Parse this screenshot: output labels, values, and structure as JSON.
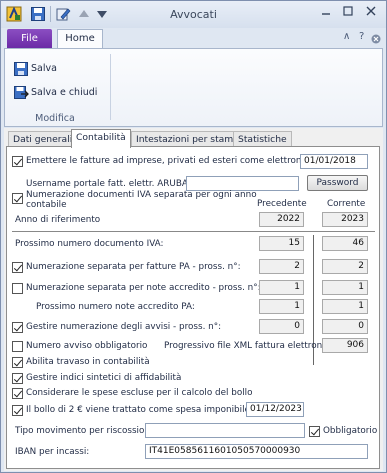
{
  "window": {
    "title": "Avvocati"
  },
  "ribbon": {
    "tabs": {
      "file": "File",
      "home": "Home"
    },
    "help_glyph": "?",
    "caret_glyph": "∧",
    "save_label": "Salva",
    "save_close_label": "Salva e chiudi",
    "group_label": "Modifica"
  },
  "form_tabs": [
    "Dati generali",
    "Contabilità",
    "Intestazioni per stampe",
    "Statistiche"
  ],
  "accounting": {
    "emit_invoices": {
      "label": "Emettere le fatture ad imprese, privati ed esteri come elettroniche dal:",
      "checked": true,
      "date": "01/01/2018"
    },
    "aruba_user": {
      "label": "Username portale fatt. elettr. ARUBA:",
      "value": "",
      "password_button": "Password"
    },
    "separate_numbering": {
      "label_line1": "Numerazione documenti IVA separata per ogni anno",
      "label_line2": "contabile",
      "checked": true
    },
    "columns": {
      "previous": "Precedente",
      "current": "Corrente"
    },
    "reference_year": {
      "label": "Anno di riferimento",
      "previous": "2022",
      "current": "2023"
    },
    "next_iva_doc": {
      "label": "Prossimo numero documento IVA:",
      "previous": "15",
      "current": "46"
    },
    "pa_invoices": {
      "label": "Numerazione separata per fatture PA - pross. n°:",
      "checked": true,
      "previous": "2",
      "current": "2"
    },
    "credit_notes": {
      "label": "Numerazione separata per note accredito - pross. n°:",
      "checked": false,
      "previous": "1",
      "current": "1"
    },
    "next_pa_credit": {
      "label": "Prossimo numero note accredito PA:",
      "previous": "1",
      "current": "1"
    },
    "notices_numbering": {
      "label": "Gestire numerazione degli avvisi - pross. n°:",
      "checked": true,
      "previous": "0",
      "current": "0"
    },
    "mandatory_notice": {
      "label": "Numero avviso obbligatorio",
      "checked": false
    },
    "xml_progressive": {
      "label": "Progressivo file XML fattura elettronica:",
      "value": "906"
    },
    "transfer_accounting": {
      "label": "Abilita travaso in contabilità",
      "checked": true
    },
    "reliability_index": {
      "label": "Gestire indici sintetici di affidabilità",
      "checked": true
    },
    "stamp_expenses": {
      "label": "Considerare le spese escluse per il calcolo del bollo",
      "checked": true
    },
    "stamp_duty": {
      "label": "Il bollo di 2 € viene trattato come spesa imponibile dal:",
      "checked": true,
      "date": "01/12/2023"
    },
    "collection_type": {
      "label": "Tipo movimento per riscossioni:",
      "value": "",
      "mandatory_label": "Obbligatorio",
      "mandatory_checked": true
    },
    "iban": {
      "label": "IBAN per incassi:",
      "value": "IT41E0585611601050570000930"
    }
  }
}
